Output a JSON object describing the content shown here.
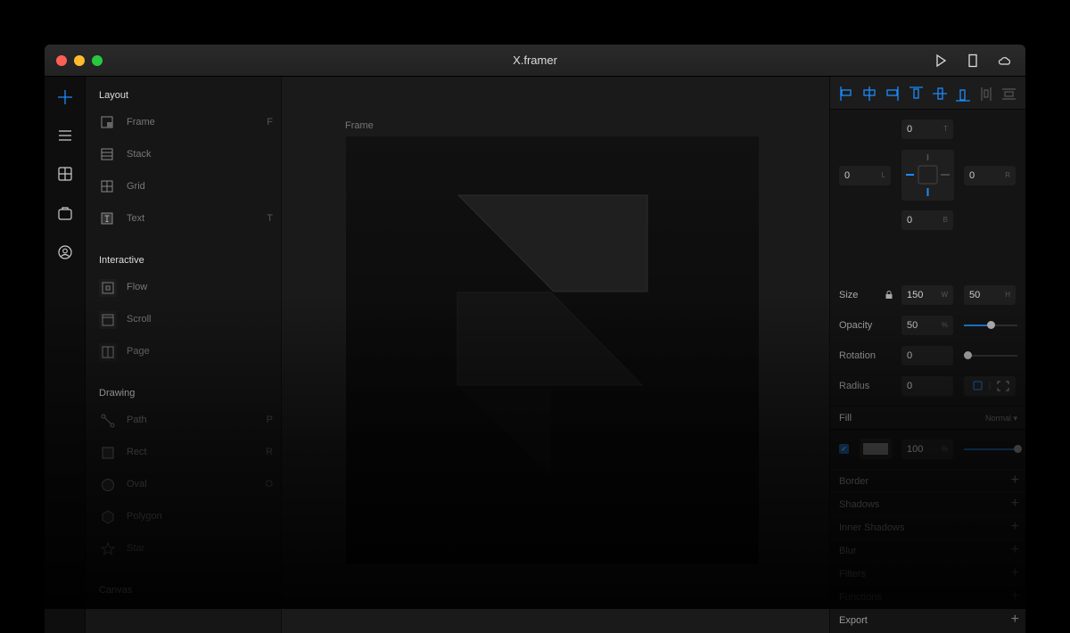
{
  "window": {
    "title": "X.framer"
  },
  "sidebar": {
    "sections": [
      {
        "title": "Layout",
        "items": [
          {
            "label": "Frame",
            "key": "F"
          },
          {
            "label": "Stack",
            "key": ""
          },
          {
            "label": "Grid",
            "key": ""
          },
          {
            "label": "Text",
            "key": "T"
          }
        ]
      },
      {
        "title": "Interactive",
        "items": [
          {
            "label": "Flow",
            "key": ""
          },
          {
            "label": "Scroll",
            "key": ""
          },
          {
            "label": "Page",
            "key": ""
          }
        ]
      },
      {
        "title": "Drawing",
        "items": [
          {
            "label": "Path",
            "key": "P"
          },
          {
            "label": "Rect",
            "key": "R"
          },
          {
            "label": "Oval",
            "key": "O"
          },
          {
            "label": "Polygon",
            "key": ""
          },
          {
            "label": "Star",
            "key": ""
          }
        ]
      },
      {
        "title": "Canvas",
        "items": []
      }
    ]
  },
  "canvas": {
    "frame_label": "Frame"
  },
  "properties": {
    "top": "0",
    "top_unit": "T",
    "left": "0",
    "left_unit": "L",
    "right": "0",
    "right_unit": "R",
    "bottom": "0",
    "bottom_unit": "B",
    "size_label": "Size",
    "width": "150",
    "width_unit": "W",
    "height": "50",
    "height_unit": "H",
    "opacity_label": "Opacity",
    "opacity": "50",
    "opacity_unit": "%",
    "opacity_slider": 0.5,
    "rotation_label": "Rotation",
    "rotation": "0",
    "rotation_slider": 0,
    "radius_label": "Radius",
    "radius": "0",
    "fill_label": "Fill",
    "blend_mode": "Normal ▾",
    "fill_checked": true,
    "fill_color": "#6e6e6e",
    "fill_opacity": "100",
    "fill_opacity_unit": "%",
    "fill_slider": 1.0,
    "sections": [
      "Border",
      "Shadows",
      "Inner Shadows",
      "Blur",
      "Filters",
      "Functions",
      "Export"
    ]
  },
  "colors": {
    "accent": "#1a8cff"
  }
}
